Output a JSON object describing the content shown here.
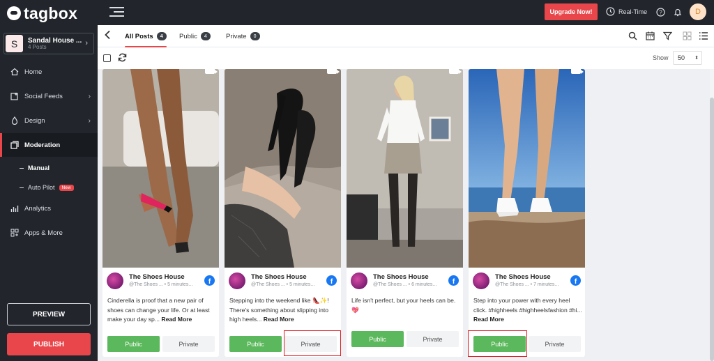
{
  "app": {
    "logo_text": "tagbox"
  },
  "account": {
    "initial": "S",
    "name": "Sandal House ...",
    "posts": "4 Posts"
  },
  "sidebar": {
    "items": [
      {
        "label": "Home",
        "icon": "home-icon"
      },
      {
        "label": "Social Feeds",
        "icon": "social-feeds-icon"
      },
      {
        "label": "Design",
        "icon": "design-icon"
      },
      {
        "label": "Moderation",
        "icon": "moderation-icon"
      },
      {
        "label": "Analytics",
        "icon": "analytics-icon"
      },
      {
        "label": "Apps & More",
        "icon": "apps-icon"
      }
    ],
    "sub_items": [
      {
        "label": "Manual"
      },
      {
        "label": "Auto Pilot",
        "badge": "New"
      }
    ],
    "preview_label": "PREVIEW",
    "publish_label": "PUBLISH"
  },
  "topbar": {
    "upgrade_label": "Upgrade Now!",
    "realtime_label": "Real-Time",
    "user_initial": "D"
  },
  "tabs": [
    {
      "label": "All Posts",
      "count": "4"
    },
    {
      "label": "Public",
      "count": "4"
    },
    {
      "label": "Private",
      "count": "0"
    }
  ],
  "toolbar": {
    "show_label": "Show",
    "show_value": "50"
  },
  "posts": [
    {
      "author": "The Shoes House",
      "handle": "@The Shoes ... • 5 minutes...",
      "caption": "Cinderella is proof that a new pair of shoes can change your life. Or at least make your day sp...",
      "read_more": "Read More",
      "public_label": "Public",
      "private_label": "Private"
    },
    {
      "author": "The Shoes House",
      "handle": "@The Shoes ... • 5 minutes...",
      "caption": "Stepping into the weekend like 👠✨! There's something about slipping into high heels...",
      "read_more": "Read More",
      "public_label": "Public",
      "private_label": "Private"
    },
    {
      "author": "The Shoes House",
      "handle": "@The Shoes ... • 6 minutes...",
      "caption": "Life isn't perfect, but your heels can be. 💖",
      "read_more": "",
      "public_label": "Public",
      "private_label": "Private"
    },
    {
      "author": "The Shoes House",
      "handle": "@The Shoes ... • 7 minutes...",
      "caption": "Step into your power with every heel click. #highheels #highheelsfashion #hi...",
      "read_more": "Read More",
      "public_label": "Public",
      "private_label": "Private"
    }
  ],
  "colors": {
    "accent": "#e8464a",
    "public_green": "#5cb85c",
    "sidebar_bg": "#22262c",
    "highlight_red": "#e01b22"
  }
}
